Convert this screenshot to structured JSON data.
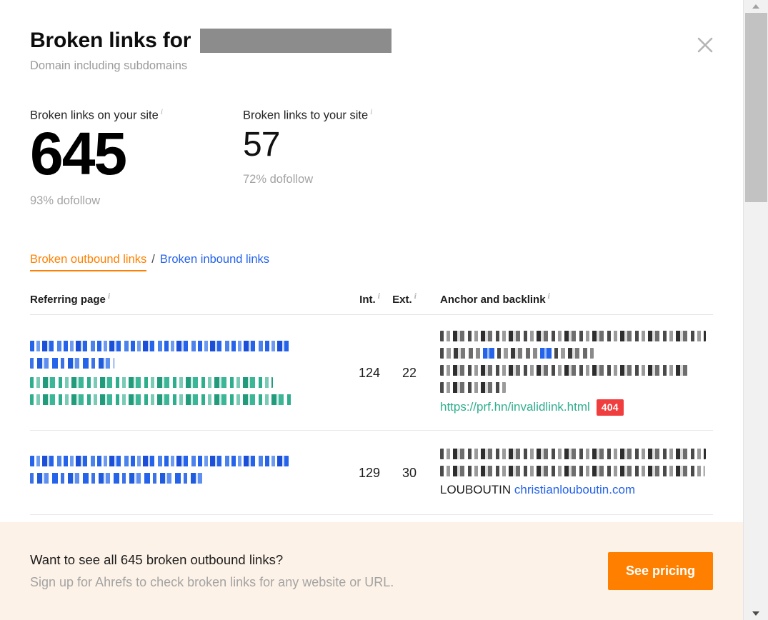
{
  "header": {
    "title": "Broken links for",
    "redacted_domain": "",
    "subtitle": "Domain including subdomains",
    "close_icon": "close-icon"
  },
  "stats": [
    {
      "label": "Broken links on your site",
      "info": "i",
      "value": "645",
      "sub": "93% dofollow"
    },
    {
      "label": "Broken links to your site",
      "info": "i",
      "value": "57",
      "sub": "72% dofollow"
    }
  ],
  "tabs": {
    "active": "Broken outbound links",
    "separator": "/",
    "inactive": "Broken inbound links",
    "active_color": "#ff8000",
    "link_color": "#2563eb"
  },
  "table": {
    "headers": {
      "referring_page": "Referring page",
      "internal": "Int.",
      "external": "Ext.",
      "anchor": "Anchor and backlink",
      "info": "i"
    },
    "rows": [
      {
        "internal": "124",
        "external": "22",
        "broken_url": "https://prf.hn/invalidlink.html",
        "status_code": "404",
        "status_color": "#f03e3e"
      },
      {
        "internal": "129",
        "external": "30",
        "anchor_text": "LOUBOUTIN",
        "anchor_link": "christianlouboutin.com"
      }
    ]
  },
  "banner": {
    "title": "Want to see all 645 broken outbound links?",
    "subtitle": "Sign up for Ahrefs to check broken links for any website or URL.",
    "button": "See pricing",
    "button_color": "#ff8000",
    "background": "#fdf2e7"
  },
  "scrollbar": {
    "up_icon": "chevron-up-icon",
    "down_icon": "chevron-down-icon"
  }
}
